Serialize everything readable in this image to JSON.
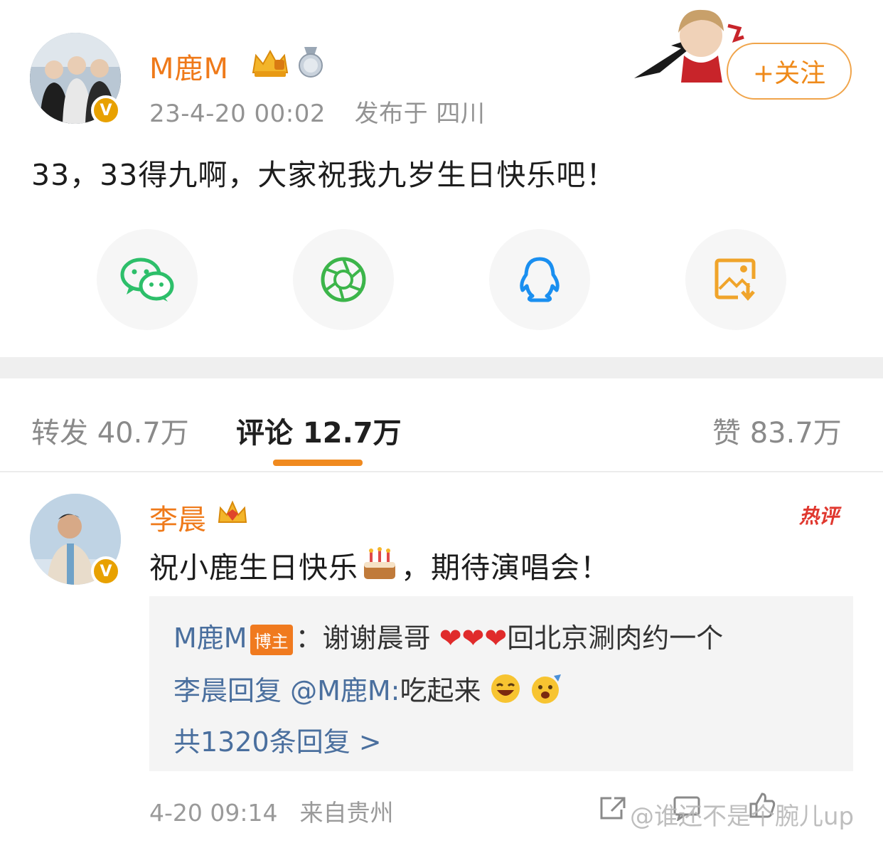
{
  "post": {
    "username": "M鹿M",
    "datetime": "23-4-20 00:02",
    "location": "发布于 四川",
    "text": "33，33得九啊，大家祝我九岁生日快乐吧！",
    "follow_label": "+关注",
    "verified_badge": "V"
  },
  "share": {
    "items": [
      {
        "icon": "wechat-icon"
      },
      {
        "icon": "moments-icon"
      },
      {
        "icon": "qq-icon"
      },
      {
        "icon": "save-image-icon"
      }
    ]
  },
  "tabs": {
    "repost": "转发 40.7万",
    "comments": "评论 12.7万",
    "likes": "赞 83.7万"
  },
  "comment": {
    "username": "李晨",
    "hot_tag": "热评",
    "text_before": "祝小鹿生日快乐",
    "text_after": "，期待演唱会！",
    "replies": {
      "line1_name": "M鹿M",
      "line1_tag": "博主",
      "line1_colon": "：谢谢晨哥",
      "line1_after": "回北京涮肉约一个",
      "line2_name": "李晨回复 @M鹿M:",
      "line2_text": "吃起来",
      "more": "共1320条回复 >"
    },
    "time": "4-20 09:14",
    "source": "来自贵州"
  },
  "watermark": "@谁还不是个腕儿up",
  "colors": {
    "accent": "#ef7a1a",
    "link": "#4a6f9e",
    "hot": "#e0382f"
  }
}
